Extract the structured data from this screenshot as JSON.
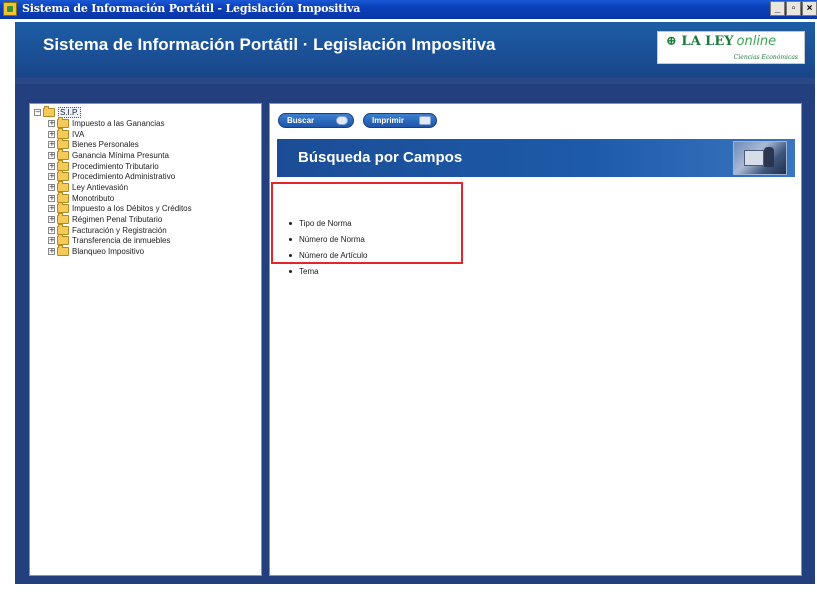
{
  "window": {
    "title": "Sistema de Información Portátil - Legislación Impositiva",
    "controls": [
      "_",
      "▫",
      "×"
    ]
  },
  "header": {
    "app_title": "Sistema de Información Portátil · Legislación Impositiva",
    "brand_main": "LA LEY",
    "brand_online": "online",
    "brand_sub": "Ciencias Económicas"
  },
  "tree": {
    "root_toggle": "−",
    "root_label": "S.I.P.",
    "items": [
      {
        "toggle": "+",
        "label": "Impuesto a las Ganancias"
      },
      {
        "toggle": "+",
        "label": "IVA"
      },
      {
        "toggle": "+",
        "label": "Bienes Personales"
      },
      {
        "toggle": "+",
        "label": "Ganancia Mínima Presunta"
      },
      {
        "toggle": "+",
        "label": "Procedimiento Tributario"
      },
      {
        "toggle": "+",
        "label": "Procedimiento Administrativo"
      },
      {
        "toggle": "+",
        "label": "Ley Antievasión"
      },
      {
        "toggle": "+",
        "label": "Monotributo"
      },
      {
        "toggle": "+",
        "label": "Impuesto a los Débitos y Créditos"
      },
      {
        "toggle": "+",
        "label": "Régimen Penal Tributario"
      },
      {
        "toggle": "+",
        "label": "Facturación y Registración"
      },
      {
        "toggle": "+",
        "label": "Transferencia de inmuebles"
      },
      {
        "toggle": "+",
        "label": "Blanqueo Impositivo"
      }
    ]
  },
  "toolbar": {
    "search_label": "Buscar",
    "print_label": "Imprimir"
  },
  "section": {
    "title": "Búsqueda por Campos"
  },
  "fields": [
    "Tipo de Norma",
    "Número de Norma",
    "Número de Artículo",
    "Tema"
  ],
  "colors": {
    "frame": "#233f7e",
    "header": "#1d5ea6",
    "brand_green": "#1b7a3a",
    "highlight": "#e3262b"
  }
}
